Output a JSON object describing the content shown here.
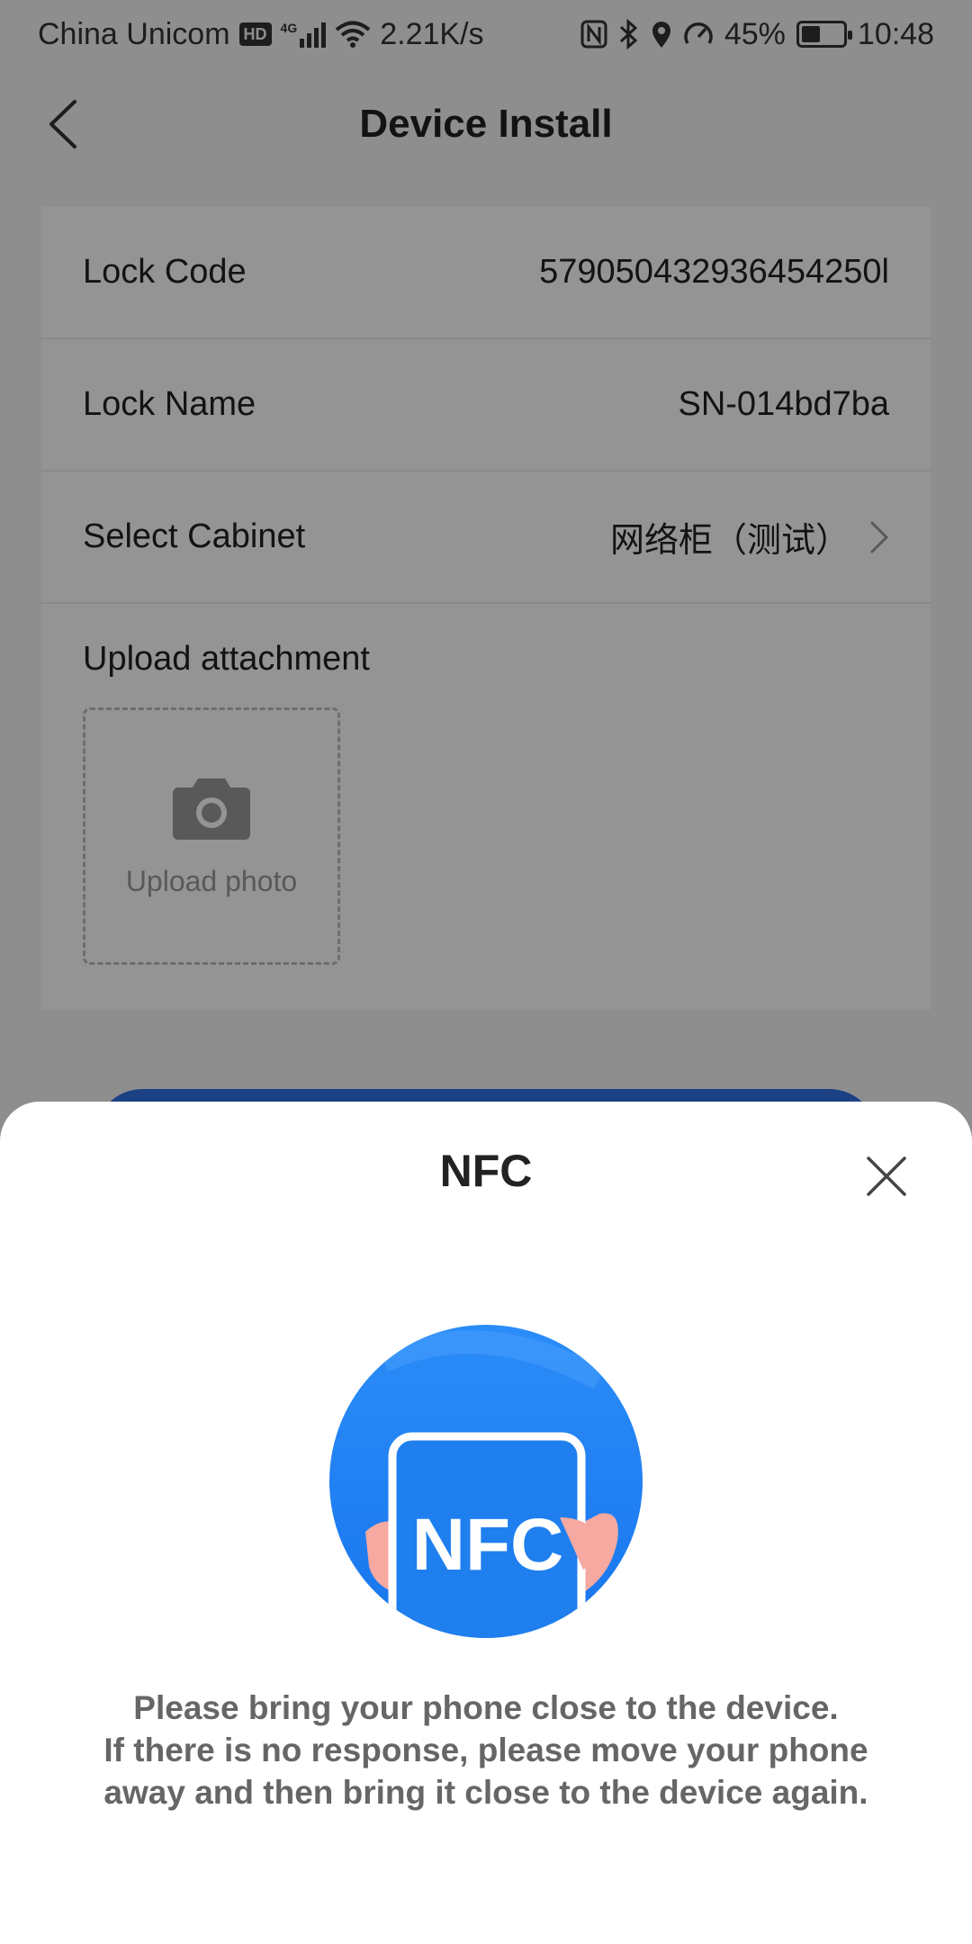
{
  "status_bar": {
    "carrier": "China Unicom",
    "hd_badge": "HD",
    "network_type": "4G",
    "speed": "2.21K/s",
    "battery_percent": "45%",
    "battery_level": 0.45,
    "time": "10:48",
    "icons": [
      "hd-icon",
      "signal-icon",
      "wifi-icon",
      "nfc-icon",
      "bluetooth-icon",
      "location-icon",
      "speedometer-icon",
      "battery-icon"
    ]
  },
  "nav": {
    "title": "Device Install",
    "back_icon": "chevron-left-icon"
  },
  "form": {
    "rows": [
      {
        "label": "Lock Code",
        "value": "579050432936454250l"
      },
      {
        "label": "Lock Name",
        "value": "SN-014bd7ba"
      },
      {
        "label": "Select Cabinet",
        "value": "网络柜（测试）"
      }
    ],
    "upload": {
      "title": "Upload attachment",
      "button_label": "Upload photo",
      "icon": "camera-icon"
    }
  },
  "nfc_sheet": {
    "title": "NFC",
    "close_icon": "close-icon",
    "illustration_text": "NFC",
    "message": [
      "Please bring your phone close to the device.",
      "If there is no response, please move your phone",
      "away and then bring it close to the device again."
    ]
  },
  "colors": {
    "accent": "#2f6fe4",
    "nfc_circle": "#2d86f5",
    "hand": "#f5a9a0",
    "overlay": "rgba(0,0,0,0.42)"
  }
}
